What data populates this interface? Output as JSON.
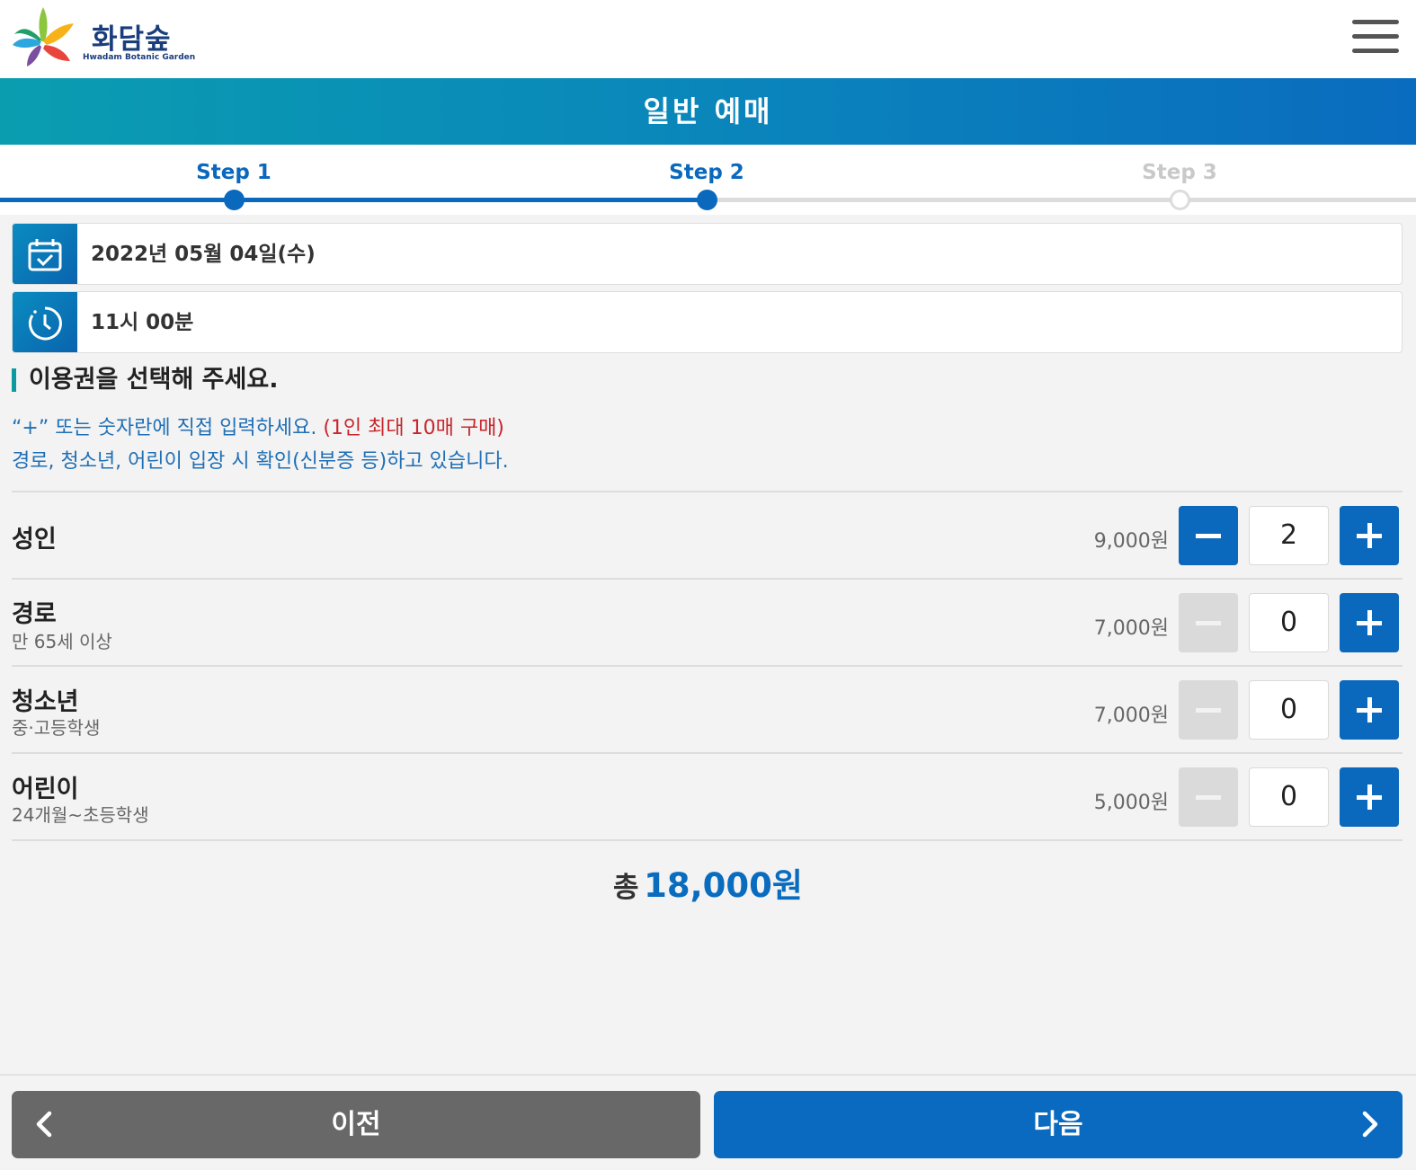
{
  "header": {
    "logo_name": "화담숲",
    "logo_sub": "Hwadam Botanic Garden",
    "menu_icon": "hamburger-icon"
  },
  "title": "일반 예매",
  "steps": [
    {
      "label": "Step 1",
      "state": "done"
    },
    {
      "label": "Step 2",
      "state": "current"
    },
    {
      "label": "Step 3",
      "state": "pending"
    }
  ],
  "selection": {
    "date": "2022년 05월 04일(수)",
    "date_icon": "calendar-check-icon",
    "time": "11시 00분",
    "time_icon": "clock-icon"
  },
  "section": {
    "title": "이용권을 선택해 주세요.",
    "note1_a": "“+” 또는 숫자란에 직접 입력하세요. ",
    "note1_b": "(1인 최대 10매 구매)",
    "note2": "경로, 청소년, 어린이 입장 시 확인(신분증 등)하고 있습니다."
  },
  "tickets": [
    {
      "name": "성인",
      "sub": "",
      "price": "9,000원",
      "qty": "2"
    },
    {
      "name": "경로",
      "sub": "만 65세 이상",
      "price": "7,000원",
      "qty": "0"
    },
    {
      "name": "청소년",
      "sub": "중·고등학생",
      "price": "7,000원",
      "qty": "0"
    },
    {
      "name": "어린이",
      "sub": "24개월~초등학생",
      "price": "5,000원",
      "qty": "0"
    }
  ],
  "total": {
    "label": "총",
    "amount": "18,000원"
  },
  "footer": {
    "prev_label": "이전",
    "next_label": "다음"
  },
  "colors": {
    "primary": "#0a68bd",
    "accent_teal": "#0a9a9f",
    "note_blue": "#1f6fb5",
    "note_red": "#c8252b",
    "prev_gray": "#686868",
    "disabled": "#dadada"
  }
}
